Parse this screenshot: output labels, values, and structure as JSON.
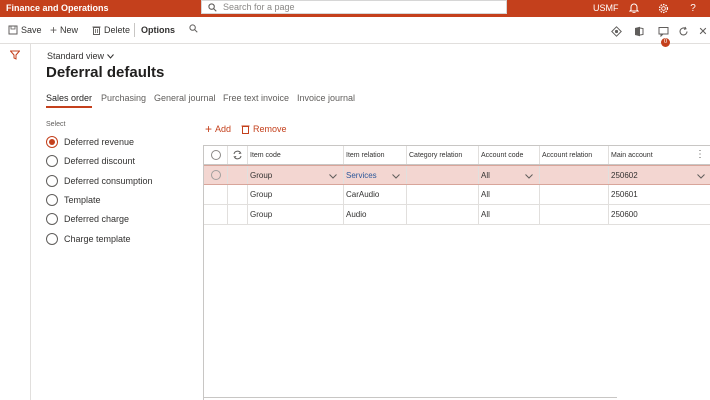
{
  "app": {
    "title": "Finance and Operations",
    "search_placeholder": "Search for a page",
    "company": "USMF",
    "notification_count": "0"
  },
  "toolbar": {
    "save": "Save",
    "new": "New",
    "delete": "Delete",
    "options": "Options"
  },
  "header": {
    "view": "Standard view",
    "title": "Deferral defaults"
  },
  "tabs": [
    "Sales order",
    "Purchasing",
    "General journal",
    "Free text invoice",
    "Invoice journal"
  ],
  "select": {
    "label": "Select",
    "options": [
      {
        "label": "Deferred revenue",
        "checked": true
      },
      {
        "label": "Deferred discount",
        "checked": false
      },
      {
        "label": "Deferred consumption",
        "checked": false
      },
      {
        "label": "Template",
        "checked": false
      },
      {
        "label": "Deferred charge",
        "checked": false
      },
      {
        "label": "Charge template",
        "checked": false
      }
    ]
  },
  "grid_toolbar": {
    "add": "Add",
    "remove": "Remove"
  },
  "grid": {
    "columns": [
      "Item code",
      "Item relation",
      "Category relation",
      "Account code",
      "Account relation",
      "Main account"
    ],
    "rows": [
      {
        "item_code": "Group",
        "item_relation": "Services",
        "category_relation": "",
        "account_code": "All",
        "account_relation": "",
        "main_account": "250602"
      },
      {
        "item_code": "Group",
        "item_relation": "CarAudio",
        "category_relation": "",
        "account_code": "All",
        "account_relation": "",
        "main_account": "250601"
      },
      {
        "item_code": "Group",
        "item_relation": "Audio",
        "category_relation": "",
        "account_code": "All",
        "account_relation": "",
        "main_account": "250600"
      }
    ]
  },
  "colors": {
    "brand": "#c4401c",
    "selected_row": "#f3d6d1",
    "link": "#2b579a"
  }
}
